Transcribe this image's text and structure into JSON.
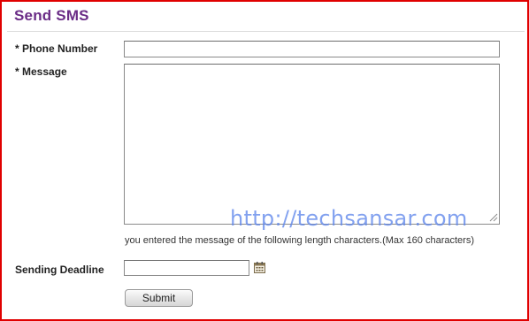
{
  "form": {
    "title": "Send SMS",
    "phone": {
      "label": "* Phone Number",
      "value": "",
      "placeholder": ""
    },
    "message": {
      "label": "* Message",
      "value": "",
      "placeholder": "",
      "length_hint": "you entered the message of the following length characters.(Max 160 characters)"
    },
    "deadline": {
      "label": "Sending Deadline",
      "value": "",
      "placeholder": "",
      "picker_icon": "calendar-icon"
    },
    "submit_label": "Submit"
  },
  "watermark": "http://techsansar.com",
  "colors": {
    "title": "#6a2c86",
    "frame_border": "#e00000",
    "watermark": "#5f87eb"
  }
}
